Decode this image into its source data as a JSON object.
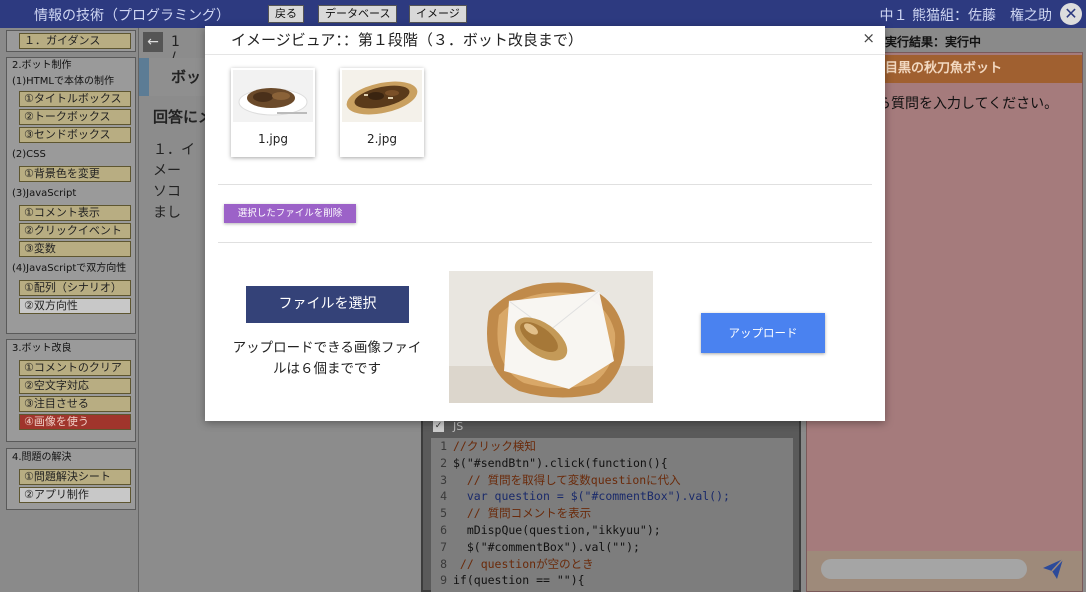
{
  "topbar": {
    "title": "情報の技術（プログラミング）",
    "nav": [
      "戻る",
      "データベース",
      "イメージ"
    ],
    "user": "中１ 熊猫組：佐藤　権之助",
    "close_glyph": "✕"
  },
  "sidebar": {
    "guide": "１．ガイダンス",
    "bot_group": {
      "title": "2.ボット制作",
      "html_sub": "(1)HTMLで本体の制作",
      "html_items": [
        "①タイトルボックス",
        "②トークボックス",
        "③センドボックス"
      ],
      "css_sub": "(2)CSS",
      "css_items": [
        "①背景色を変更"
      ],
      "js_sub": "(3)JavaScript",
      "js_items": [
        "①コメント表示",
        "②クリックイベント",
        "③変数"
      ],
      "two_sub": "(4)JavaScriptで双方向性",
      "two_items": [
        "①配列（シナリオ）",
        "②双方向性"
      ]
    },
    "improve_group": {
      "title": "3.ボット改良",
      "items": [
        "①コメントのクリア",
        "②空文字対応",
        "③注目させる",
        "④画像を使う"
      ],
      "active_index": 3
    },
    "problem_group": {
      "title": "4.問題の解決",
      "items": [
        "①問題解決シート",
        "②アプリ制作"
      ]
    }
  },
  "main": {
    "page_indicator": "1 / 4",
    "bot_title": "ボッ",
    "answer_label": "回答にメ",
    "question_text": "１．イメー\nソコ\nまし"
  },
  "code": {
    "section_label": "JS",
    "lines": [
      {
        "n": "1",
        "text": "//クリック検知",
        "style": "comment"
      },
      {
        "n": "2",
        "text": "$(\"#sendBtn\").click(function(){",
        "style": "normal"
      },
      {
        "n": "3",
        "text": "  // 質問を取得して変数questionに代入",
        "style": "comment"
      },
      {
        "n": "4",
        "text": "  var question = $(\"#commentBox\").val();",
        "style": "blue"
      },
      {
        "n": "5",
        "text": "  // 質問コメントを表示",
        "style": "comment"
      },
      {
        "n": "6",
        "text": "  mDispQue(question,\"ikkyuu\");",
        "style": "normal"
      },
      {
        "n": "7",
        "text": "  $(\"#commentBox\").val(\"\");",
        "style": "normal"
      },
      {
        "n": "8",
        "text": " // questionが空のとき",
        "style": "comment"
      },
      {
        "n": "9",
        "text": "if(question == \"\"){",
        "style": "normal"
      }
    ]
  },
  "right": {
    "status": "実行結果：実行中",
    "chat_title": "目黒の秋刀魚ボット",
    "chat_message": "ら質問を入力してください。",
    "send_icon": "paper-plane-icon"
  },
  "modal": {
    "title": "イメージビュア：：第１段階（３．ボット改良まで）",
    "close_glyph": "×",
    "thumbnails": [
      {
        "name": "1.jpg"
      },
      {
        "name": "2.jpg"
      }
    ],
    "delete_label": "選択したファイルを削除",
    "choose_label": "ファイルを選択",
    "note": "アップロードできる画像ファイルは６個までです",
    "upload_label": "アップロード"
  },
  "colors": {
    "topbar": "#2d3a80",
    "choose_button": "#344278",
    "delete_button": "#9c62c8",
    "upload_button": "#4a82f0",
    "active_item": "#a0352c"
  }
}
